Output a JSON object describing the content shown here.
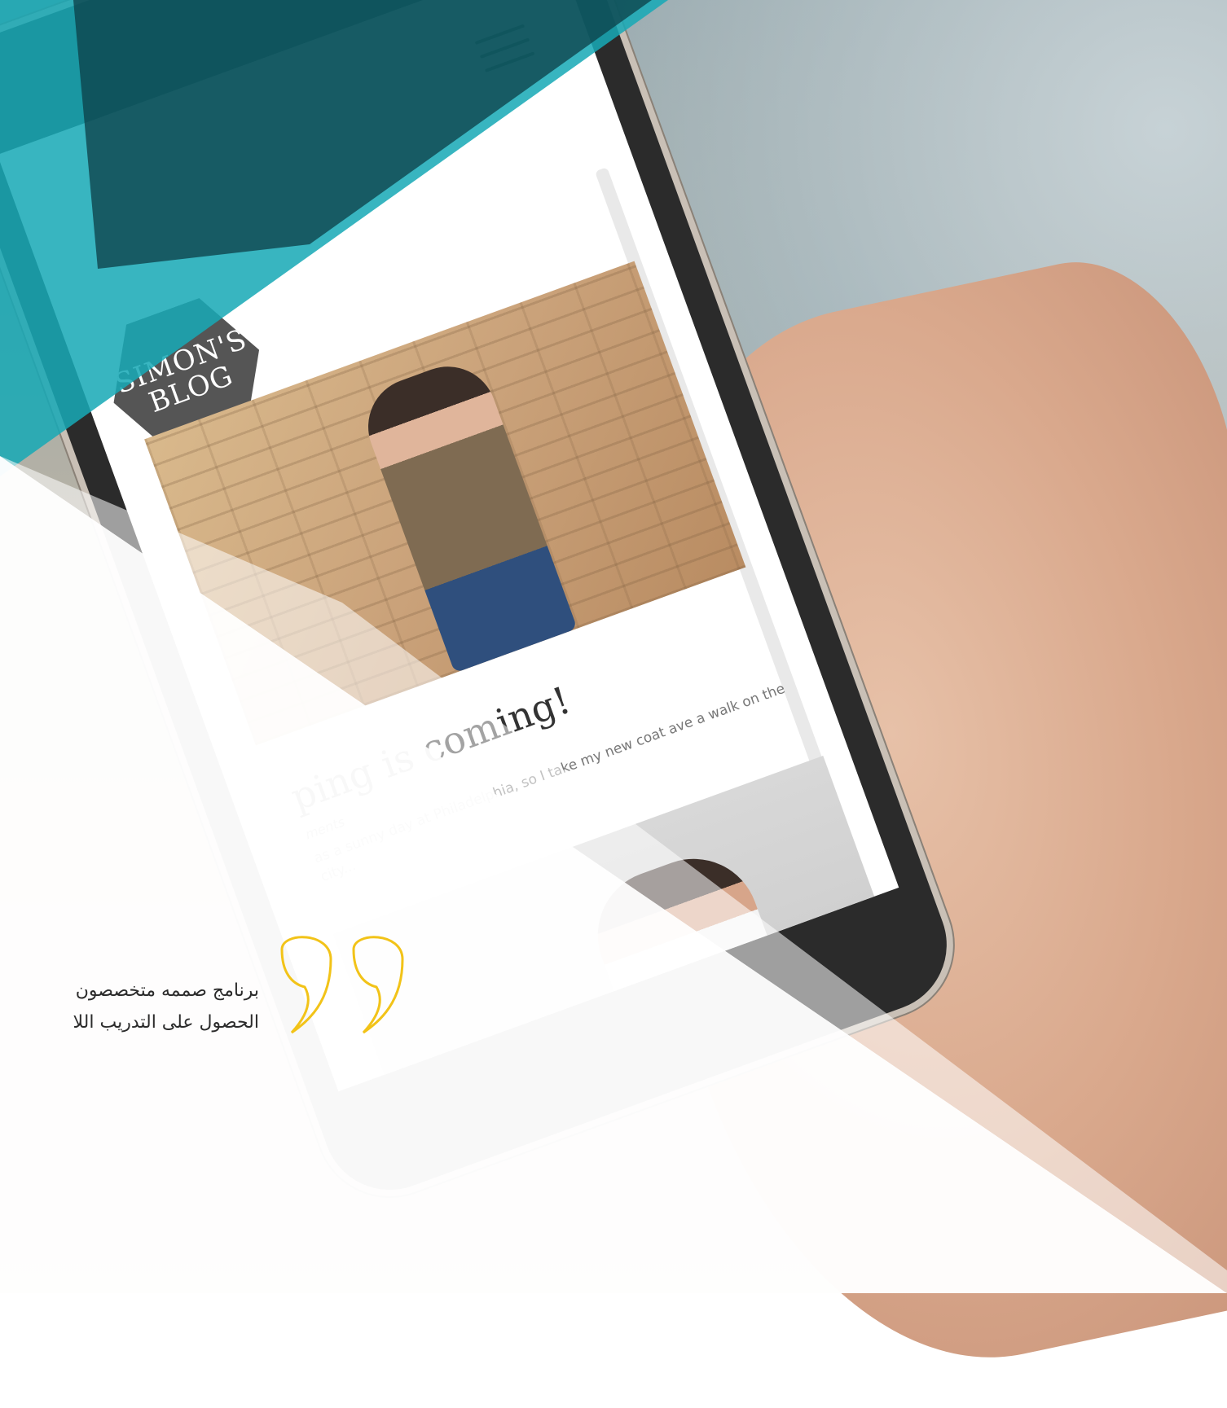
{
  "blog": {
    "logo_line1": "SIMON'S",
    "logo_line2": "BLOG",
    "post1_title": "ping is coming!",
    "post1_meta": "ments",
    "post1_excerpt": "as a sunny day at Philadelphia, so I take my new coat  ave a walk on the city..."
  },
  "quote": {
    "line1": "برنامج صممه متخصصون",
    "line2": "الحصول على التدريب اللا"
  },
  "colors": {
    "teal": "#17a9b6",
    "teal_dark": "#0c3d45",
    "quote_accent": "#f2c318"
  },
  "icons": {
    "menu": "hamburger-menu-icon",
    "quote": "quote-icon"
  }
}
